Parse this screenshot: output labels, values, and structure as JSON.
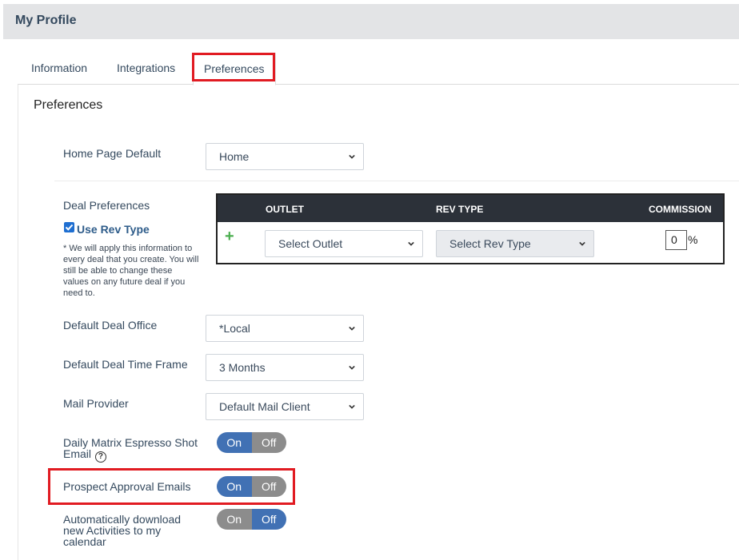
{
  "header": {
    "title": "My Profile"
  },
  "tabs": [
    {
      "label": "Information"
    },
    {
      "label": "Integrations"
    },
    {
      "label": "Preferences"
    }
  ],
  "section_title": "Preferences",
  "home_page": {
    "label": "Home Page Default",
    "value": "Home"
  },
  "deal_prefs": {
    "label": "Deal Preferences",
    "checkbox_label": "Use Rev Type",
    "checkbox_checked": true,
    "note": "* We will apply this information to every deal that you create. You will still be able to change these values on any future deal if you need to.",
    "table": {
      "headers": [
        "OUTLET",
        "REV TYPE",
        "COMMISSION"
      ],
      "add_icon": "+",
      "outlet_placeholder": "Select Outlet",
      "rev_type_placeholder": "Select Rev Type",
      "commission": "0",
      "percent": "%"
    }
  },
  "deal_office": {
    "label": "Default Deal Office",
    "value": "*Local"
  },
  "time_frame": {
    "label": "Default Deal Time Frame",
    "value": "3 Months"
  },
  "mail_provider": {
    "label": "Mail Provider",
    "value": "Default Mail Client"
  },
  "toggles": [
    {
      "label_line1": "Daily Matrix Espresso Shot",
      "label_line2": "Email",
      "on": "On",
      "off": "Off",
      "state": "on",
      "help_icon": "?"
    },
    {
      "label_line1": "Prospect Approval Emails",
      "on": "On",
      "off": "Off",
      "state": "on"
    },
    {
      "label_line1": "Automatically download",
      "label_line2": "new Activities to my",
      "label_line3": "calendar",
      "on": "On",
      "off": "Off",
      "state": "off"
    }
  ],
  "colors": {
    "accent_blue": "#4171b4",
    "highlight_red": "#e11b22",
    "header_dark": "#2c3139"
  }
}
